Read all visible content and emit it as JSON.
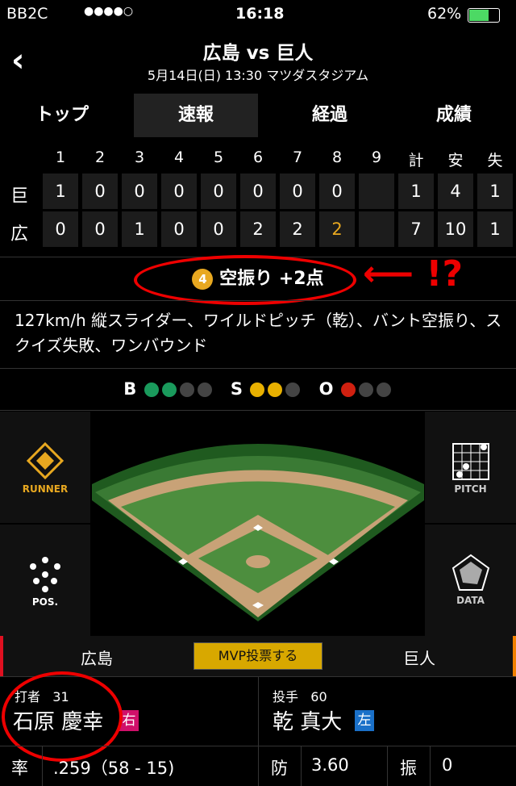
{
  "status": {
    "carrier": "BB2C",
    "time": "16:18",
    "battery": "62%"
  },
  "header": {
    "title": "広島 vs 巨人",
    "subtitle": "5月14日(日) 13:30 マツダスタジアム"
  },
  "tabs": [
    {
      "label": "トップ"
    },
    {
      "label": "速報",
      "active": true
    },
    {
      "label": "経過"
    },
    {
      "label": "成績"
    }
  ],
  "scoreboard": {
    "headers": [
      "1",
      "2",
      "3",
      "4",
      "5",
      "6",
      "7",
      "8",
      "9",
      "計",
      "安",
      "失"
    ],
    "rows": [
      {
        "team": "巨",
        "cells": [
          "1",
          "0",
          "0",
          "0",
          "0",
          "0",
          "0",
          "0",
          "",
          "1",
          "4",
          "1"
        ]
      },
      {
        "team": "広",
        "cells": [
          "0",
          "0",
          "1",
          "0",
          "0",
          "2",
          "2",
          "2",
          "",
          "7",
          "10",
          "1"
        ]
      }
    ],
    "highlight_color": "#e8a820"
  },
  "play": {
    "out_num": "4",
    "text": "空振り +2点",
    "annotation": "⟵ !?"
  },
  "description": "127km/h 縦スライダー、ワイルドピッチ（乾）、バント空振り、スクイズ失敗、ワンバウンド",
  "count": {
    "b_label": "B",
    "s_label": "S",
    "o_label": "O",
    "balls": 2,
    "strikes": 2,
    "outs": 1,
    "colors": {
      "ball": "#1a9a5c",
      "strike": "#e8b000",
      "out": "#d02010"
    }
  },
  "side_buttons": {
    "runner": "RUNNER",
    "pos": "POS.",
    "pitch": "PITCH",
    "data": "DATA"
  },
  "teams": {
    "home": "広島",
    "away": "巨人",
    "mvp": "MVP投票する"
  },
  "batter": {
    "label": "打者",
    "number": "31",
    "name": "石原 慶幸",
    "hand": "右",
    "stat_label": "率",
    "stat": ".259（58 - 15)"
  },
  "pitcher": {
    "label": "投手",
    "number": "60",
    "name": "乾 真大",
    "hand": "左",
    "era_label": "防",
    "era": "3.60",
    "k_label": "振",
    "k": "0"
  }
}
